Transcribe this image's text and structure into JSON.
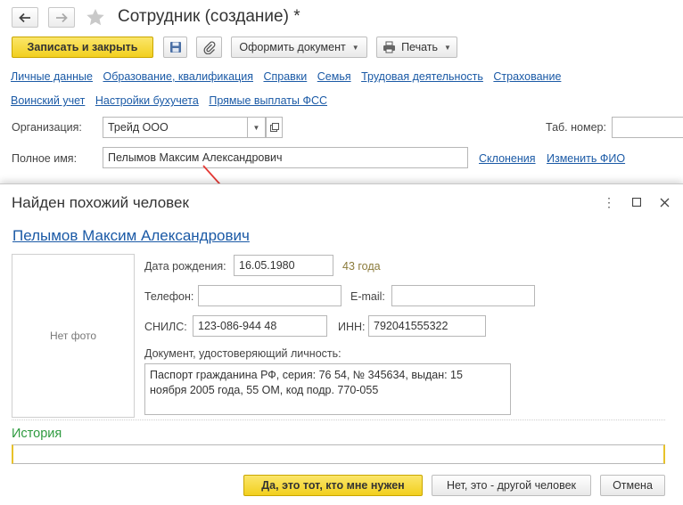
{
  "window": {
    "title": "Сотрудник (создание) *"
  },
  "toolbar": {
    "save_close": "Записать и закрыть",
    "create_document": "Оформить документ",
    "print": "Печать"
  },
  "tabs": [
    "Личные данные",
    "Образование, квалификация",
    "Справки",
    "Семья",
    "Трудовая деятельность",
    "Страхование",
    "Воинский учет",
    "Настройки бухучета",
    "Прямые выплаты ФСС"
  ],
  "form": {
    "organization_label": "Организация:",
    "organization_value": "Трейд ООО",
    "tab_number_label": "Таб. номер:",
    "fullname_label": "Полное имя:",
    "fullname_value": "Пелымов Максим Александрович",
    "declensions_link": "Склонения",
    "change_name_link": "Изменить ФИО"
  },
  "dialog": {
    "title": "Найден похожий человек",
    "person_name": "Пелымов Максим Александрович",
    "no_photo": "Нет фото",
    "birth_label": "Дата рождения:",
    "birth_value": "16.05.1980",
    "age": "43 года",
    "phone_label": "Телефон:",
    "phone_value": "",
    "email_label": "E-mail:",
    "email_value": "",
    "snils_label": "СНИЛС:",
    "snils_value": "123-086-944 48",
    "inn_label": "ИНН:",
    "inn_value": "792041555322",
    "document_label": "Документ, удостоверяющий личность:",
    "document_value": "Паспорт гражданина РФ, серия: 76 54, № 345634, выдан: 15\nноября 2005 года, 55 ОМ, код подр. 770-055",
    "history_label": "История",
    "yes_button": "Да, это тот, кто мне нужен",
    "no_button": "Нет, это - другой человек",
    "cancel_button": "Отмена"
  },
  "colors": {
    "accent_yellow": "#f5d327",
    "link_blue": "#1b5aa6",
    "history_green": "#2e9a3f",
    "arrow_red": "#e53935"
  }
}
